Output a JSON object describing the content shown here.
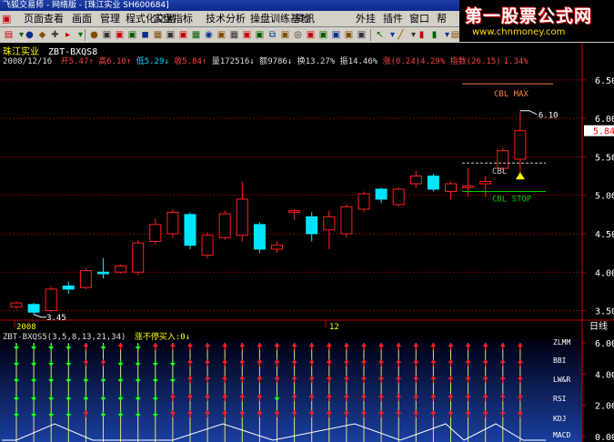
{
  "window": {
    "title": "飞狐交易师 - 网络版 - [珠江实业 SH600684]"
  },
  "brand": {
    "name": "第一股票公式网",
    "url": "www.chnmoney.com"
  },
  "menu": [
    "页面",
    "查看",
    "画面",
    "管理",
    "程式化交易",
    "实盘指标",
    "技术分析",
    "操盘训练基地",
    "资讯",
    "外挂",
    "插件",
    "窗口",
    "帮"
  ],
  "toolbar": {
    "quan_label": "权"
  },
  "stock": {
    "name": "珠江实业",
    "formula": "ZBT-BXQS8"
  },
  "info": {
    "date": "2008/12/16",
    "open_label": "开",
    "open": "5.47",
    "high_label": "高",
    "high": "6.10",
    "low_label": "低",
    "low": "5.29",
    "close_label": "收",
    "close": "5.84",
    "vol_label": "量",
    "vol": "172516",
    "amt_label": "额",
    "amt": "9786",
    "turn_label": "换",
    "turn": "13.27%",
    "amp_label": "振",
    "amp": "14.46%",
    "chg_label": "涨",
    "chg": "(0.24)",
    "chg_pct": "4.29%",
    "idx_label": "指数",
    "idx": "(26.15)",
    "idx_pct": "1.34%"
  },
  "annotations": {
    "cbl_max": "CBL MAX",
    "cbl": "CBL",
    "cbl_stop": "CBL STOP",
    "high_mark": "6.10",
    "low_mark": "3.45"
  },
  "price_axis": {
    "ticks": [
      "6.50",
      "6.00",
      "5.50",
      "5.00",
      "4.50",
      "4.00",
      "3.50"
    ],
    "current": "5.84"
  },
  "time_axis": {
    "labels": [
      "2008",
      "12"
    ],
    "period": "日线"
  },
  "indicator": {
    "title": "ZBT-BXQS5(3,5,8,13,21,34)",
    "signal": "涨不停买入:0",
    "row_labels": [
      "ZLMM",
      "BBI",
      "LW&R",
      "RSI",
      "KDJ",
      "MACD"
    ],
    "axis_ticks": [
      "6.00",
      "4.00",
      "2.00",
      "0.00"
    ]
  },
  "colors": {
    "up": "#ff2020",
    "down": "#00e5ff",
    "grid": "#800000",
    "axis": "#c00000",
    "label": "#ffffff",
    "yellow": "#ffff00",
    "green": "#00cc00"
  },
  "chart_data": {
    "type": "candlestick",
    "ylim": [
      3.4,
      6.7
    ],
    "candles": [
      {
        "o": 3.55,
        "h": 3.62,
        "l": 3.52,
        "c": 3.6
      },
      {
        "o": 3.58,
        "h": 3.6,
        "l": 3.45,
        "c": 3.48
      },
      {
        "o": 3.5,
        "h": 3.82,
        "l": 3.48,
        "c": 3.78
      },
      {
        "o": 3.82,
        "h": 3.88,
        "l": 3.72,
        "c": 3.78
      },
      {
        "o": 3.8,
        "h": 4.05,
        "l": 3.78,
        "c": 4.02
      },
      {
        "o": 4.0,
        "h": 4.18,
        "l": 3.92,
        "c": 3.98
      },
      {
        "o": 4.0,
        "h": 4.1,
        "l": 3.98,
        "c": 4.08
      },
      {
        "o": 4.0,
        "h": 4.42,
        "l": 3.96,
        "c": 4.38
      },
      {
        "o": 4.4,
        "h": 4.7,
        "l": 4.36,
        "c": 4.62
      },
      {
        "o": 4.5,
        "h": 4.82,
        "l": 4.45,
        "c": 4.78
      },
      {
        "o": 4.75,
        "h": 4.78,
        "l": 4.3,
        "c": 4.35
      },
      {
        "o": 4.22,
        "h": 4.52,
        "l": 4.18,
        "c": 4.48
      },
      {
        "o": 4.45,
        "h": 4.8,
        "l": 4.42,
        "c": 4.76
      },
      {
        "o": 4.48,
        "h": 5.18,
        "l": 4.4,
        "c": 4.95
      },
      {
        "o": 4.62,
        "h": 4.65,
        "l": 4.25,
        "c": 4.3
      },
      {
        "o": 4.3,
        "h": 4.4,
        "l": 4.25,
        "c": 4.35
      },
      {
        "o": 4.78,
        "h": 4.82,
        "l": 4.68,
        "c": 4.8
      },
      {
        "o": 4.72,
        "h": 4.78,
        "l": 4.4,
        "c": 4.5
      },
      {
        "o": 4.55,
        "h": 4.8,
        "l": 4.3,
        "c": 4.72
      },
      {
        "o": 4.5,
        "h": 4.88,
        "l": 4.45,
        "c": 4.85
      },
      {
        "o": 4.82,
        "h": 5.05,
        "l": 4.78,
        "c": 5.02
      },
      {
        "o": 5.08,
        "h": 5.1,
        "l": 4.9,
        "c": 4.95
      },
      {
        "o": 4.88,
        "h": 5.1,
        "l": 4.85,
        "c": 5.08
      },
      {
        "o": 5.15,
        "h": 5.32,
        "l": 5.1,
        "c": 5.25
      },
      {
        "o": 5.25,
        "h": 5.28,
        "l": 5.05,
        "c": 5.08
      },
      {
        "o": 5.05,
        "h": 5.18,
        "l": 4.95,
        "c": 5.15
      },
      {
        "o": 5.1,
        "h": 5.35,
        "l": 4.98,
        "c": 5.12
      },
      {
        "o": 5.15,
        "h": 5.25,
        "l": 4.98,
        "c": 5.18
      },
      {
        "o": 5.35,
        "h": 5.62,
        "l": 5.32,
        "c": 5.58
      },
      {
        "o": 5.47,
        "h": 6.1,
        "l": 5.29,
        "c": 5.84
      }
    ],
    "cbl_max": 6.45,
    "cbl": 5.42,
    "cbl_stop": 5.05,
    "indicator_arrows": [
      "ddddd",
      "ddddd",
      "ddddd",
      "ddddd",
      "uuddu",
      "duddd",
      "udddd",
      "ddddd",
      "udddd",
      "udduu",
      "uuuuu",
      "uuuuu",
      "uuuuu",
      "uuuuu",
      "uuuuu",
      "uuudu",
      "uuuuu",
      "uuuuu",
      "uuuuu",
      "uuuuu",
      "uuuuu",
      "uuuuu",
      "uuuuu",
      "uuuuu",
      "uuuuu",
      "uuuuu",
      "uuuuu",
      "uuuuu",
      "uuuuu",
      "uuuuu"
    ]
  }
}
